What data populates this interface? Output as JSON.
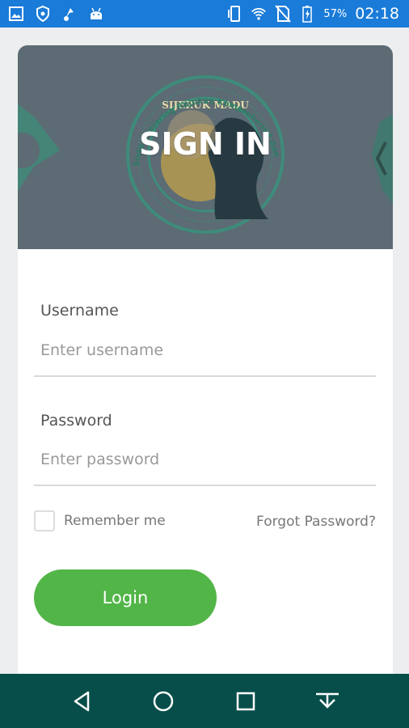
{
  "status_bar": {
    "battery_percent": "57%",
    "time": "02:18",
    "icons": [
      "image-icon",
      "shield-icon",
      "music-bolt-icon",
      "android-icon",
      "vibrate-icon",
      "wifi-icon",
      "no-sim-icon",
      "battery-icon"
    ]
  },
  "banner": {
    "title": "SIGN IN",
    "logo_text": [
      "SIJERUK MADU",
      "Sistem Jejaring Rujukan Komprehensif dan Manajemen Persalinan Terpadu"
    ]
  },
  "form": {
    "username": {
      "label": "Username",
      "placeholder": "Enter username",
      "value": ""
    },
    "password": {
      "label": "Password",
      "placeholder": "Enter password",
      "value": ""
    },
    "remember_label": "Remember me",
    "remember_checked": false,
    "forgot_label": "Forgot Password?",
    "login_label": "Login"
  },
  "colors": {
    "status_bar": "#1a7bd8",
    "login_button": "#52b547",
    "nav_bar": "#074e4a",
    "banner_overlay": "#5c6b74"
  },
  "nav_bar": {
    "icons": [
      "back-icon",
      "home-icon",
      "recents-icon",
      "download-icon"
    ]
  }
}
